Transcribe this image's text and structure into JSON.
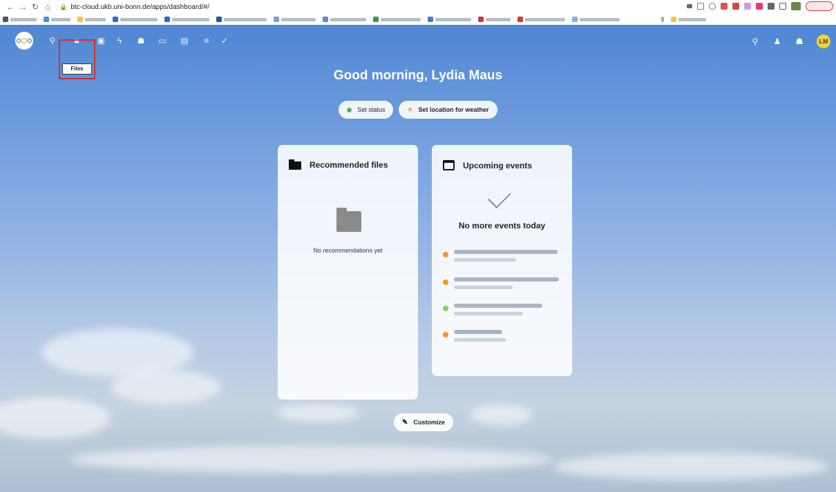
{
  "browser": {
    "url": "btc-cloud.ukb.uni-bonn.de/apps/dashboard/#/"
  },
  "nav": {
    "files_tooltip": "Files"
  },
  "header": {
    "avatar_initials": "LM"
  },
  "greeting": "Good morning, Lydia Maus",
  "status": {
    "set_status_label": "Set status",
    "weather_label": "Set location for weather",
    "status_color": "#54b06b"
  },
  "widgets": {
    "files": {
      "title": "Recommended files",
      "empty_text": "No recommendations yet"
    },
    "events": {
      "title": "Upcoming events",
      "empty_text": "No more events today",
      "items": [
        {
          "color": "#f39a1c"
        },
        {
          "color": "#f39a1c"
        },
        {
          "color": "#7ed35a"
        },
        {
          "color": "#f39a1c"
        }
      ]
    }
  },
  "customize_label": "Customize"
}
